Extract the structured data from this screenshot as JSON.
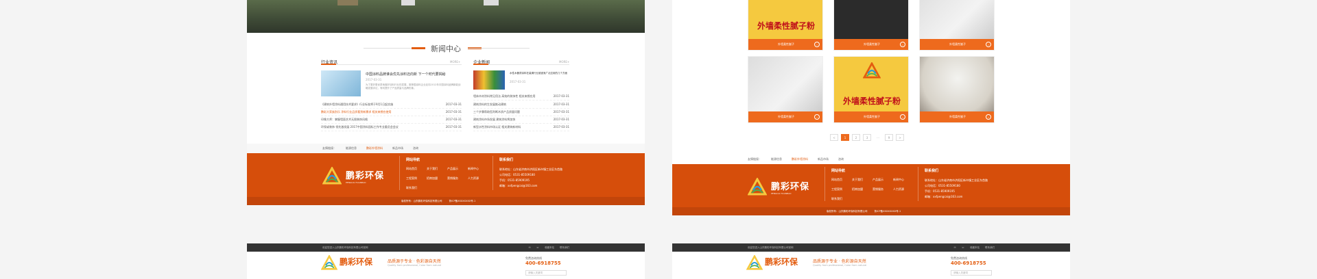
{
  "left": {
    "news_heading": "新闻中心",
    "industry": {
      "title": "行业资讯",
      "more": "MORE+",
      "lead_title": "中国涂料品牌谁会优先涂料迈向新 下一个时代要揭秘",
      "lead_date": "2017-03-31",
      "lead_desc": "为了更好更优质地做好涂料行业的发展，推荐国涂料企业走向2012年中国涂料品牌新能战略发展评论，有利提升了产品质量与品牌形象。",
      "items": [
        {
          "title": "《建筑外墙涂料通用技术要求》行业标准将于9月1日起实施",
          "date": "2017-03-31"
        },
        {
          "title": "鹏彩大家族别乐 涂料行业品质看到新需求 相关来想应使用",
          "date": "2017-03-31"
        },
        {
          "title": "印像大师：掌握墙面艺术无限装饰风格",
          "date": "2017-03-31"
        },
        {
          "title": "环保或装饰 领先激发展 2017中国涂料园标工作专业委员会会议",
          "date": "2017-03-31"
        }
      ]
    },
    "company": {
      "title": "企业新闻",
      "more": "MORE+",
      "lead_title": "水性木器漆涂料在装潢行业被逐渐广泛应用的几个方面",
      "lead_date": "2017-03-31",
      "items": [
        {
          "title": "墙体木材涂料常见用法 高效的装饰性 相关来想应用",
          "date": "2017-03-31"
        },
        {
          "title": "建筑涂料的生发展推动建筑",
          "date": "2017-03-31"
        },
        {
          "title": "三个步骤帮助您判断木质产品质量问题",
          "date": "2017-03-31"
        },
        {
          "title": "建筑涂料市场发展 建筑涂料将加快",
          "date": "2017-03-31"
        },
        {
          "title": "新型水性涂料市场认证 相关建筑新材料",
          "date": "2017-03-31"
        }
      ]
    },
    "links": [
      "友情链接：",
      "能源信息",
      "鹏彩外墙涂料",
      "新品市场",
      "咨询"
    ],
    "footer": {
      "brand_cn": "鹏彩环保",
      "brand_en": "PENGCAI HUANBAO",
      "nav_heading": "网站导航",
      "nav": [
        "网站首页",
        "关于我们",
        "产品展示",
        "新闻中心",
        "工程案例",
        "招商加盟",
        "营销服务",
        "人力资源",
        "联系我们"
      ],
      "contact_heading": "联系我们",
      "contact": [
        "联系地址：山东省济南市济阳区新市镇工业区东首路",
        "公司电话：0531-85509180",
        "手机：0531-85909195",
        "邮箱：xxfpengcai@163.com"
      ],
      "copyright": "版权所有：山东鹏彩环保科技有限公司",
      "icp": "鲁ICP备XXXXXXXX号-1"
    }
  },
  "right": {
    "products": [
      {
        "name": "外墙柔性腻子",
        "big": "外墙柔性腻子粉"
      },
      {
        "name": "外墙柔性腻子"
      },
      {
        "name": "外墙柔性腻子"
      },
      {
        "name": "外墙柔性腻子"
      },
      {
        "name": "外墙柔性腻子",
        "big": "外墙柔性腻子粉"
      },
      {
        "name": "外墙柔性腻子"
      }
    ],
    "pager": [
      "<",
      "1",
      "2",
      "3",
      "...",
      "9",
      ">"
    ],
    "links": [
      "友情链接：",
      "能源信息",
      "鹏彩外墙涂料",
      "新品市场",
      "咨询"
    ],
    "footer": {
      "brand_cn": "鹏彩环保",
      "brand_en": "PENGCAI HUANBAO",
      "nav_heading": "网站导航",
      "nav": [
        "网站首页",
        "关于我们",
        "产品展示",
        "新闻中心",
        "工程案例",
        "招商加盟",
        "营销服务",
        "人力资源",
        "联系我们"
      ],
      "contact_heading": "联系我们",
      "contact": [
        "联系地址：山东省济南市济阳区新市镇工业区东首路",
        "公司电话：0531-85509180",
        "手机：0531-85909195",
        "邮箱：xxfpengcai@163.com"
      ],
      "copyright": "版权所有：山东鹏彩环保科技有限公司",
      "icp": "鲁ICP备XXXXXXXX号-1"
    }
  },
  "header_variant": {
    "welcome": "欢迎您进入山东鹏彩环保科技有限公司官网",
    "links": [
      "收藏本站",
      "联系我们"
    ],
    "brand_cn": "鹏彩环保",
    "slogan": "品质源于专业 · 色彩源自天然",
    "sub": "Quality from professional, Color from natural",
    "hotline_label": "免费咨询热线",
    "hotline": "400-6918755",
    "search_placeholder": "请输入关键词"
  },
  "colors": {
    "accent": "#e35d10",
    "footer": "#d64e0b",
    "product_bar": "#ee6a1d"
  }
}
